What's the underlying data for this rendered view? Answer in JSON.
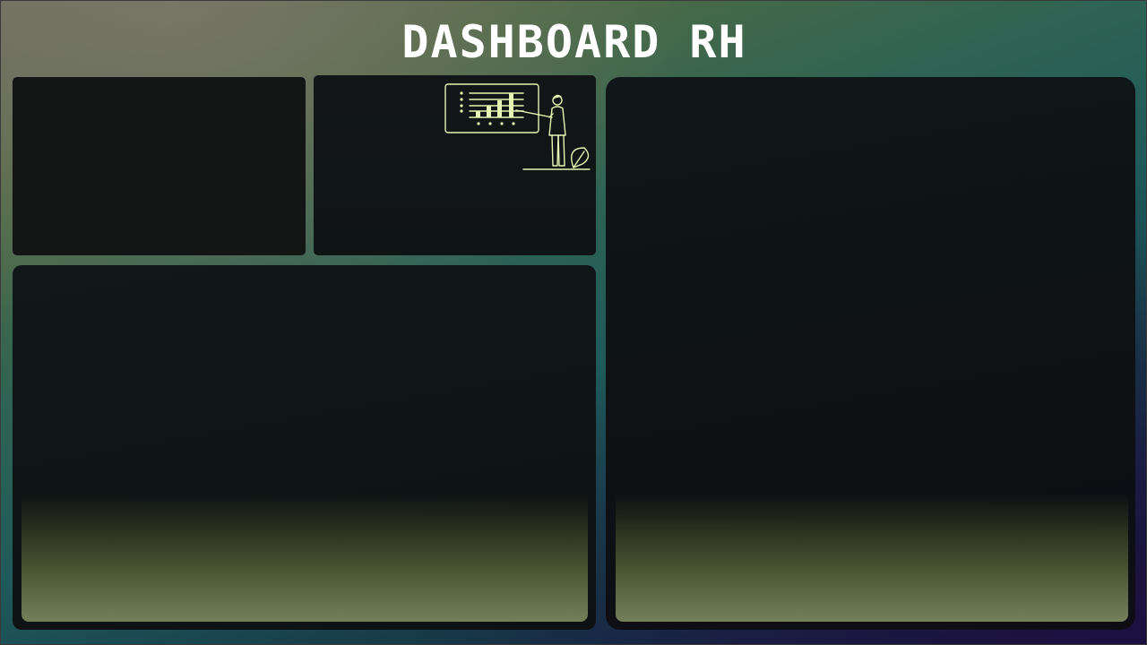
{
  "header": {
    "title": "DASHBOARD RH"
  },
  "illustration": {
    "icon": "presenter-with-chart-icon",
    "accent_color": "#e6f5b4"
  },
  "panels": [
    {
      "id": "top-left",
      "content": ""
    },
    {
      "id": "top-middle",
      "content": ""
    },
    {
      "id": "bottom-left",
      "content": ""
    },
    {
      "id": "right",
      "content": ""
    }
  ],
  "colors": {
    "panel_background": "#111617",
    "title_color": "#ffffff",
    "fade_accent": "#73805a"
  }
}
